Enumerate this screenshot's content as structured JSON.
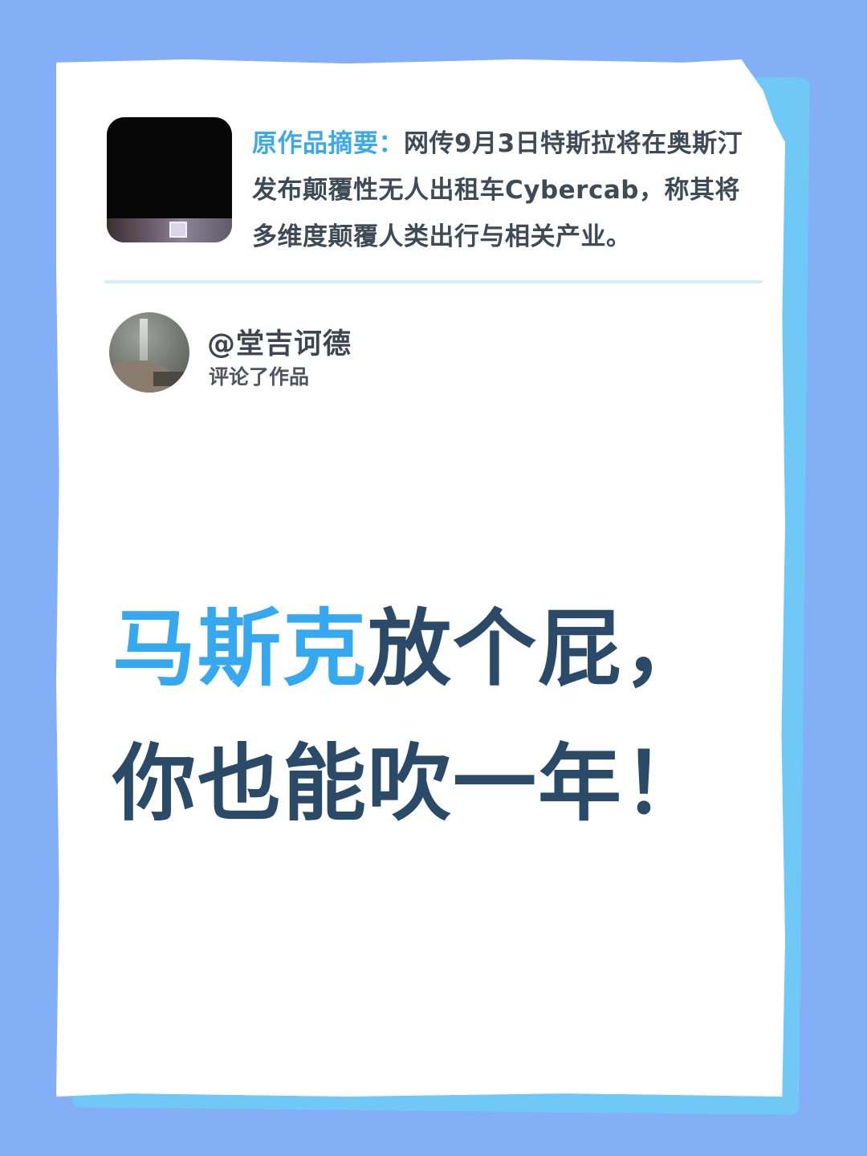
{
  "summary": {
    "label": "原作品摘要：",
    "text": "网传9月3日特斯拉将在奥斯汀发布颠覆性无人出租车Cybercab，称其将多维度颠覆人类出行与相关产业。"
  },
  "comment": {
    "username": "@堂吉诃德",
    "action": "评论了作品"
  },
  "headline": {
    "highlight": "马斯克",
    "rest_line1": "放个屁，",
    "line2": "你也能吹一年！"
  },
  "colors": {
    "background": "#84aef6",
    "accent_blue": "#35a8ef",
    "headline_dark": "#2a4a67",
    "paper_edge": "#6fc8f6"
  }
}
